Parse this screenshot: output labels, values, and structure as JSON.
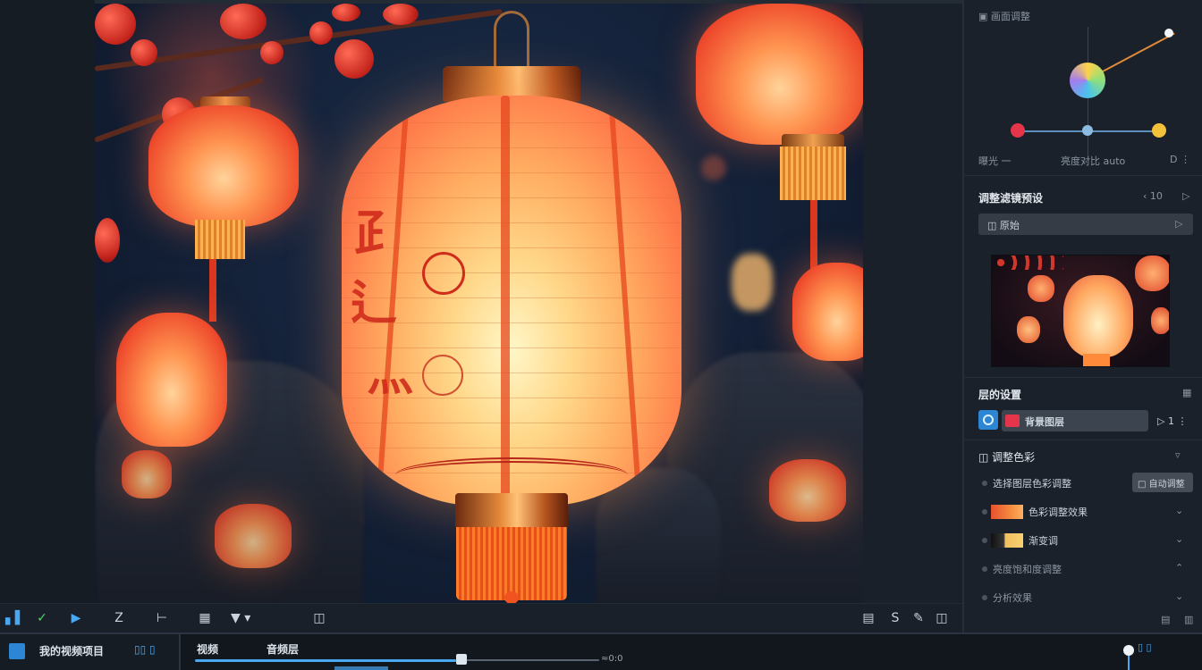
{
  "panel": {
    "top_label": "▣ 画面调整",
    "graph_bottom_left": "曝光 一",
    "graph_bottom_mid": "亮度对比 auto",
    "graph_bottom_right": "D ⋮",
    "section1_title": "调整滤镜预设",
    "section1_right": "‹ 10",
    "section1_next": "▷",
    "preset_field": "◫ 原始",
    "preset_field_right": "▷",
    "section2_title": "层的设置",
    "section2_icon": "▦",
    "layer_name": "背景图层",
    "layer_right": "▷ 1 ⋮",
    "section3_title": "◫ 调整色彩",
    "section3_chev": "▿",
    "row1_label": "选择图层色彩调整",
    "row1_button": "□ 自动调整",
    "row2_label": "色彩调整效果",
    "row3_label": "渐变调",
    "row4_label": "亮度饱和度调整",
    "row5_label": "分析效果",
    "footer_icons": [
      "▤",
      "▥"
    ]
  },
  "toolbar": {
    "tools": [
      "▖▌",
      "✓",
      "▶",
      "Z",
      "⊢",
      "▦",
      "▼ ▾",
      "◫"
    ],
    "right_tools": [
      "▤",
      "S",
      "✎",
      "◫"
    ]
  },
  "timeline": {
    "track_title": "我的视频项目",
    "track_controls": "▯▯   ▯",
    "label_a": "视频",
    "label_b": "音频层",
    "time_marker": "≈0:0",
    "end_icons": "▯ ▯"
  },
  "colors": {
    "accent": "#4aa8f0",
    "lantern": "#ff7b4a",
    "panel_bg": "#1b212a"
  }
}
